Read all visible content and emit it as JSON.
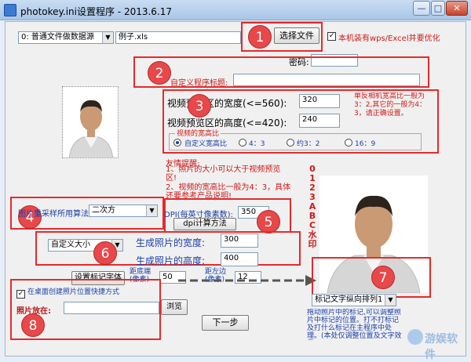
{
  "window": {
    "title": "photokey.ini设置程序 - 2013.6.17",
    "minimize": "—",
    "maximize": "□",
    "close": "✕"
  },
  "top": {
    "source_select": "0: 普通文件做数据源",
    "source_file": "例子.xls",
    "choose_file_button": "选择文件",
    "wps_checkbox_label": "本机装有wps/Excel并要优化",
    "password_label": "密码:",
    "password_value": ""
  },
  "title_field": {
    "label": "自定义程序标题:",
    "value": ""
  },
  "preview": {
    "width_label": "视频预览区的宽度(<=560):",
    "width_value": "320",
    "height_label": "视频预览区的高度(<=420):",
    "height_value": "240",
    "tip": "单反相机宽高比一般为3：2,其它的一般为4：3，请正确设置。",
    "ratio_group": "视频的宽高比",
    "ratios": [
      "自定义宽高比",
      "4：3",
      "约3：2",
      "16：9"
    ]
  },
  "reminder": {
    "title": "友情提醒:",
    "line1": "1、照片的大小可以大于视频预览区!",
    "line2": "2、视频的宽高比一般为4：3，具体还要参考产品说明!"
  },
  "resample": {
    "label": "图片重采样所用算法:",
    "value": "二次方"
  },
  "dpi": {
    "label": "DPI(每英寸像素数):",
    "value": "350",
    "calc_button": "dpi计算方法"
  },
  "output": {
    "size_select": "自定义大小",
    "width_label": "生成照片的宽度:",
    "width_value": "300",
    "height_label": "生成照片的高度:",
    "height_value": "400"
  },
  "marker": {
    "font_button": "设置标记字体",
    "bottom_label": "距底端(像素)",
    "bottom_value": "50",
    "left_label": "距左边(像素)",
    "left_value": "12",
    "direction_select": "标记文字纵向排列1",
    "vertical_text": "0123ABC水印",
    "tip": "拖动照片中的标记,可以调整照片中标记的位置。打不打标记及打什么标记在主程序中处理。(本处仅调整位置及文字效果)"
  },
  "shortcut": {
    "checkbox_label": "在桌面创建照片位置快捷方式",
    "save_label": "照片放在:",
    "save_value": "",
    "browse_button": "浏览"
  },
  "next_button": "下一步",
  "badges": [
    "1",
    "2",
    "3",
    "4",
    "5",
    "6",
    "7",
    "8"
  ],
  "watermark_text": "游娱软件",
  "colors": {
    "accent_red": "#e62a2a",
    "label_blue": "#1a3ea8",
    "badge_red": "#e7484a"
  }
}
